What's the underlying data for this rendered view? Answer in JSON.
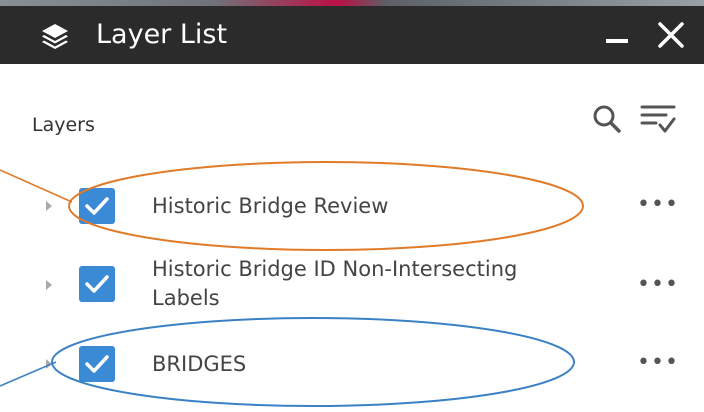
{
  "window": {
    "title": "Layer List",
    "icon": "layers-icon",
    "minimize_icon": "minimize-icon",
    "close_icon": "close-icon"
  },
  "panel": {
    "section_label": "Layers",
    "search_icon": "search-icon",
    "filter_icon": "filter-list-icon"
  },
  "layers": [
    {
      "label": "Historic Bridge Review",
      "checked": true,
      "annotated": true
    },
    {
      "label": "Historic Bridge ID Non-Intersecting Labels",
      "line1": "Historic Bridge ID Non-Intersecting",
      "line2": "Labels",
      "checked": true,
      "annotated": false
    },
    {
      "label": "BRIDGES",
      "checked": true,
      "annotated": true
    }
  ],
  "menu_glyph": "•••",
  "colors": {
    "titlebar": "#2b2b2b",
    "checkbox": "#3a8ad6",
    "annotation_orange": "#e07b2a",
    "annotation_blue": "#3b82c4"
  }
}
